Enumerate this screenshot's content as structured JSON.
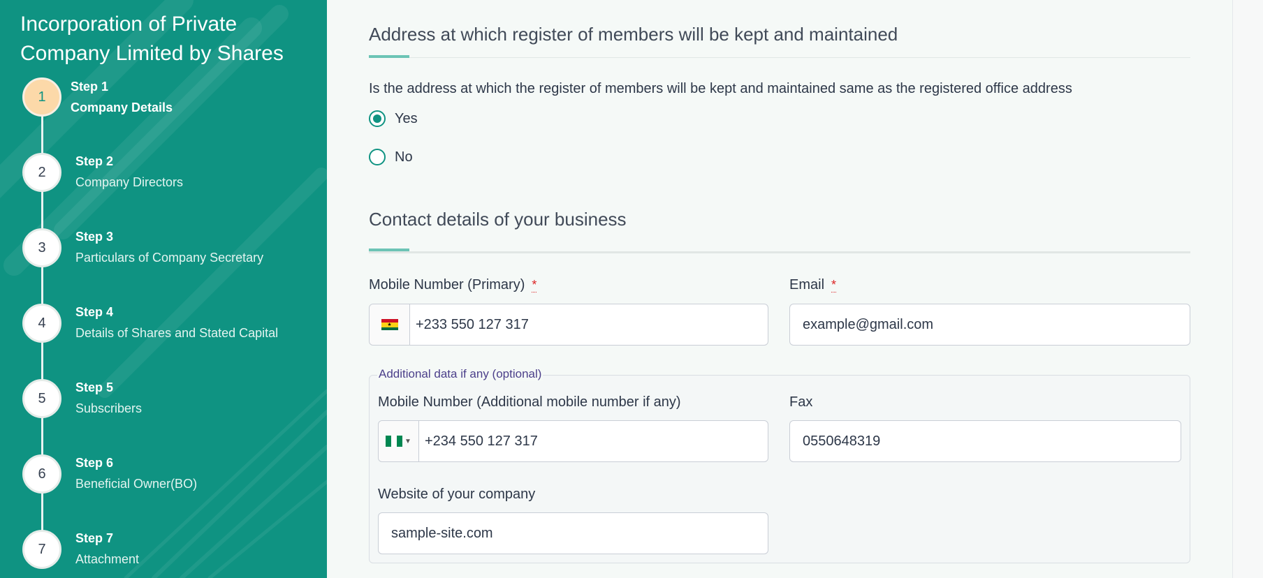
{
  "sidebar": {
    "title": "Incorporation of Private Company Limited by Shares",
    "steps": [
      {
        "number": "1",
        "label": "Step 1",
        "name": "Company Details",
        "active": true
      },
      {
        "number": "2",
        "label": "Step 2",
        "name": "Company Directors",
        "active": false
      },
      {
        "number": "3",
        "label": "Step 3",
        "name": "Particulars of Company Secretary",
        "active": false
      },
      {
        "number": "4",
        "label": "Step 4",
        "name": "Details of Shares and Stated Capital",
        "active": false
      },
      {
        "number": "5",
        "label": "Step 5",
        "name": "Subscribers",
        "active": false
      },
      {
        "number": "6",
        "label": "Step 6",
        "name": "Beneficial Owner(BO)",
        "active": false
      },
      {
        "number": "7",
        "label": "Step 7",
        "name": "Attachment",
        "active": false
      }
    ]
  },
  "register_section": {
    "title": "Address at which register of members will be kept and maintained",
    "question": "Is the address at which the register of members will be kept and maintained same as the registered office address",
    "options": [
      {
        "label": "Yes",
        "selected": true
      },
      {
        "label": "No",
        "selected": false
      }
    ]
  },
  "contact_section": {
    "title": "Contact details of your business",
    "mobile_primary": {
      "label": "Mobile Number (Primary)",
      "required_mark": "*",
      "country_flag": "ghana-flag-icon",
      "value": "+233 550 127 317"
    },
    "email": {
      "label": "Email",
      "required_mark": "*",
      "value": "example@gmail.com"
    },
    "additional": {
      "legend": "Additional data if any (optional)",
      "mobile_additional": {
        "label": "Mobile Number (Additional mobile number if any)",
        "country_flag": "nigeria-flag-icon",
        "value": "+234 550 127 317"
      },
      "fax": {
        "label": "Fax",
        "value": "0550648319"
      },
      "website": {
        "label": "Website of your company",
        "value": "sample-site.com"
      }
    }
  },
  "colors": {
    "sidebar_bg": "#0f9382",
    "accent": "#0f9382",
    "active_step": "#fcd9a9",
    "required": "#dc2626"
  }
}
